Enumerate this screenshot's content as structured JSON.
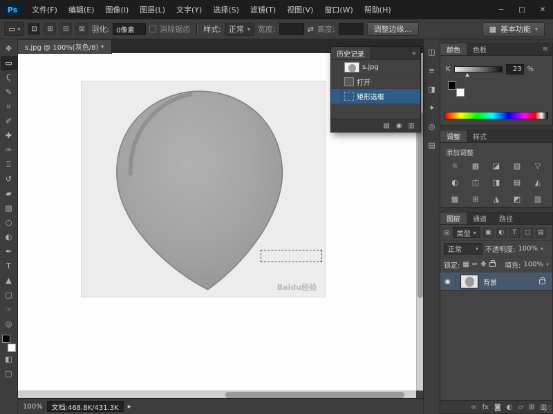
{
  "window": {
    "logo": "Ps",
    "controls": {
      "min": "─",
      "max": "□",
      "close": "✕"
    }
  },
  "menus": [
    "文件(F)",
    "编辑(E)",
    "图像(I)",
    "图层(L)",
    "文字(Y)",
    "选择(S)",
    "滤镜(T)",
    "视图(V)",
    "窗口(W)",
    "帮助(H)"
  ],
  "options": {
    "tool_glyph": "▭",
    "dropdown_arrow": "▾",
    "mode_icons": {
      "new": "⊡",
      "add": "⊞",
      "subtract": "⊟",
      "intersect": "⊠"
    },
    "feather_label": "羽化:",
    "feather_value": "0像素",
    "antialias": "消除锯齿",
    "style_label": "样式:",
    "style_value": "正常",
    "width_label": "宽度:",
    "swap": "⇄",
    "height_label": "高度:",
    "refine_edge": "调整边缘…",
    "workspace_icon": "▦",
    "workspace": "基本功能"
  },
  "tools": [
    {
      "name": "move",
      "glyph": "✥"
    },
    {
      "name": "rectangular-marquee",
      "glyph": "▭",
      "selected": true
    },
    {
      "name": "lasso",
      "glyph": "Ϛ"
    },
    {
      "name": "quick-selection",
      "glyph": "✎"
    },
    {
      "name": "crop",
      "glyph": "⌗"
    },
    {
      "name": "eyedropper",
      "glyph": "✐"
    },
    {
      "name": "healing-brush",
      "glyph": "✚"
    },
    {
      "name": "brush",
      "glyph": "✑"
    },
    {
      "name": "clone-stamp",
      "glyph": "♖"
    },
    {
      "name": "history-brush",
      "glyph": "↺"
    },
    {
      "name": "eraser",
      "glyph": "▰"
    },
    {
      "name": "gradient",
      "glyph": "▨"
    },
    {
      "name": "blur",
      "glyph": "○"
    },
    {
      "name": "dodge",
      "glyph": "◐"
    },
    {
      "name": "pen",
      "glyph": "✒"
    },
    {
      "name": "type",
      "glyph": "T"
    },
    {
      "name": "path-selection",
      "glyph": "▲"
    },
    {
      "name": "shape",
      "glyph": "▢"
    },
    {
      "name": "hand",
      "glyph": "☞"
    },
    {
      "name": "zoom",
      "glyph": "◎"
    }
  ],
  "doc": {
    "tab": "s.jpg @ 100%(灰色/8) *",
    "watermark": "Baidu经验"
  },
  "history": {
    "title": "历史记录",
    "collapse": "»",
    "items": [
      {
        "label": "s.jpg"
      },
      {
        "label": "打开"
      },
      {
        "label": "矩形选框"
      }
    ],
    "footer_icons": {
      "new_doc": "▤",
      "snapshot": "◉",
      "trash": "▥"
    }
  },
  "collapsed_icons": [
    "◫",
    "≡",
    "◨",
    "✦",
    "◎",
    "▤"
  ],
  "color": {
    "tabs": [
      "颜色",
      "色板"
    ],
    "menu_icon": "≡",
    "channel": "K",
    "value": "23",
    "percent": "%"
  },
  "adjustments": {
    "tabs": [
      "调整",
      "样式"
    ],
    "title": "添加调整",
    "icons": [
      "☼",
      "▦",
      "◪",
      "▧",
      "▽",
      "◐",
      "◫",
      "◨",
      "▤",
      "◭",
      "▩",
      "⊞",
      "◮",
      "◩",
      "▥"
    ]
  },
  "layers": {
    "tabs": [
      "图层",
      "通道",
      "路径"
    ],
    "filter_icon": "◎",
    "filter_label": "类型",
    "filter_icons": [
      "▣",
      "◐",
      "T",
      "▢",
      "▤"
    ],
    "blend_mode": "正常",
    "opacity_label": "不透明度:",
    "opacity_value": "100%",
    "lock_label": "锁定:",
    "lock_icons": [
      "▦",
      "✑",
      "✥"
    ],
    "fill_label": "填充:",
    "fill_value": "100%",
    "eye": "◉",
    "layer_name": "背景",
    "bottom_icons": [
      "∞",
      "fx",
      "◙",
      "◐",
      "▱",
      "⊞",
      "▥"
    ]
  },
  "status": {
    "zoom": "100%",
    "doc_info": "文档:468.8K/431.3K",
    "arrow": "▸"
  }
}
